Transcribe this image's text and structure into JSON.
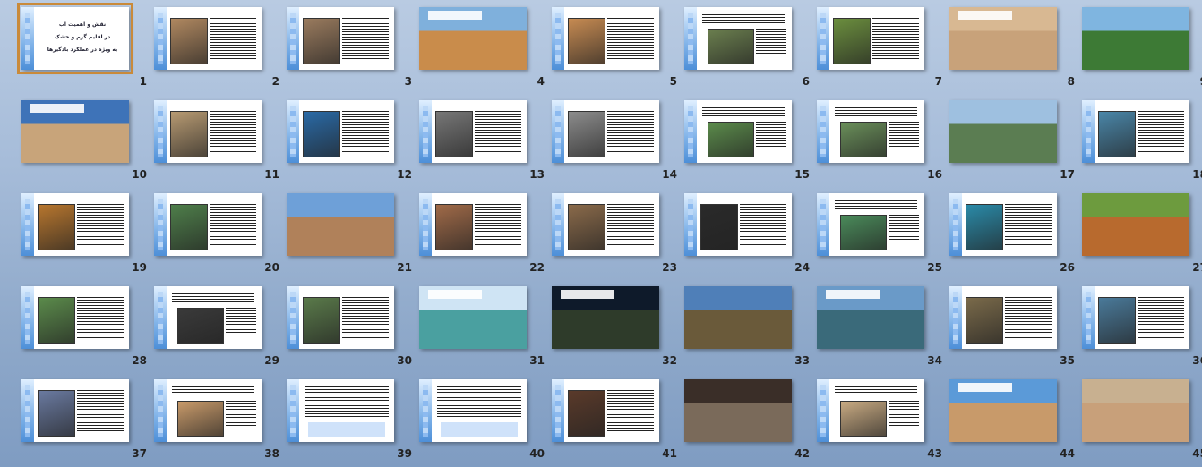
{
  "slides": [
    {
      "num": "1",
      "layout": "title",
      "selected": true,
      "lines": [
        "نقش و اهمیت آب",
        "در اقلیم گرم و خشک",
        "به ویژه در عملکرد بادگیرها"
      ]
    },
    {
      "num": "2",
      "layout": "imgL",
      "img": "#b08860"
    },
    {
      "num": "3",
      "layout": "imgL",
      "img": "#9a7b5e"
    },
    {
      "num": "4",
      "layout": "full",
      "img": "#c98c4b",
      "sky": "#7fb0dc"
    },
    {
      "num": "5",
      "layout": "imgL",
      "img": "#c78b52",
      "sky": "#5f8ec0"
    },
    {
      "num": "6",
      "layout": "imgC",
      "img": "#6a7e4e"
    },
    {
      "num": "7",
      "layout": "imgL",
      "img": "#6b8e3e"
    },
    {
      "num": "8",
      "layout": "full",
      "img": "#c8a27a",
      "sky": "#d8b892"
    },
    {
      "num": "9",
      "layout": "full",
      "img": "#3d7a35",
      "sky": "#7fb5e0"
    },
    {
      "num": "10",
      "layout": "full",
      "img": "#c8a47a",
      "sky": "#3e73b8"
    },
    {
      "num": "11",
      "layout": "imgL",
      "img": "#b79a72"
    },
    {
      "num": "12",
      "layout": "imgL",
      "img": "#2a6aa6"
    },
    {
      "num": "13",
      "layout": "imgL",
      "img": "#777777"
    },
    {
      "num": "14",
      "layout": "imgL",
      "img": "#8c8c8c"
    },
    {
      "num": "15",
      "layout": "imgC",
      "img": "#5b8b4b"
    },
    {
      "num": "16",
      "layout": "imgC",
      "img": "#6a8f5a"
    },
    {
      "num": "17",
      "layout": "full",
      "img": "#5b7d52",
      "sky": "#9ec0e0"
    },
    {
      "num": "18",
      "layout": "imgL",
      "img": "#4a86a8"
    },
    {
      "num": "19",
      "layout": "imgL",
      "img": "#b7762e"
    },
    {
      "num": "20",
      "layout": "imgL",
      "img": "#4e7e4a"
    },
    {
      "num": "21",
      "layout": "full",
      "img": "#b0815a",
      "sky": "#6ea0d8"
    },
    {
      "num": "22",
      "layout": "imgL",
      "img": "#a06a48"
    },
    {
      "num": "23",
      "layout": "imgL",
      "img": "#8a6a4a"
    },
    {
      "num": "24",
      "layout": "imgL",
      "img": "#2a2a2a"
    },
    {
      "num": "25",
      "layout": "imgC",
      "img": "#4a8a5a"
    },
    {
      "num": "26",
      "layout": "imgL",
      "img": "#2a8aa8"
    },
    {
      "num": "27",
      "layout": "full",
      "img": "#b86a2e",
      "sky": "#6d9b3e"
    },
    {
      "num": "28",
      "layout": "imgL",
      "img": "#5b8b4b"
    },
    {
      "num": "29",
      "layout": "imgC",
      "img": "#3a3a3a"
    },
    {
      "num": "30",
      "layout": "imgL",
      "img": "#5a7a4a"
    },
    {
      "num": "31",
      "layout": "full",
      "img": "#4aa0a0",
      "sky": "#cfe4f4"
    },
    {
      "num": "32",
      "layout": "full",
      "img": "#2e3b2a",
      "sky": "#0e1a2a"
    },
    {
      "num": "33",
      "layout": "full",
      "img": "#6a5a3a",
      "sky": "#4f7fb8"
    },
    {
      "num": "34",
      "layout": "full",
      "img": "#3a6a7a",
      "sky": "#6a9ac8"
    },
    {
      "num": "35",
      "layout": "imgL",
      "img": "#7a6a4a"
    },
    {
      "num": "36",
      "layout": "imgL",
      "img": "#4a7a9a"
    },
    {
      "num": "37",
      "layout": "imgL",
      "img": "#6a7aa0"
    },
    {
      "num": "38",
      "layout": "imgC",
      "img": "#c89a6a"
    },
    {
      "num": "39",
      "layout": "text",
      "img": "#ffffff"
    },
    {
      "num": "40",
      "layout": "text",
      "img": "#ffffff"
    },
    {
      "num": "41",
      "layout": "imgL",
      "img": "#5a3a2a"
    },
    {
      "num": "42",
      "layout": "full",
      "img": "#7a6a5a",
      "sky": "#3a2e28"
    },
    {
      "num": "43",
      "layout": "imgC",
      "img": "#c8aa82"
    },
    {
      "num": "44",
      "layout": "full",
      "img": "#c89a6a",
      "sky": "#5b9ad8"
    },
    {
      "num": "45",
      "layout": "full",
      "img": "#c8a07a",
      "sky": "#c8b090"
    }
  ]
}
